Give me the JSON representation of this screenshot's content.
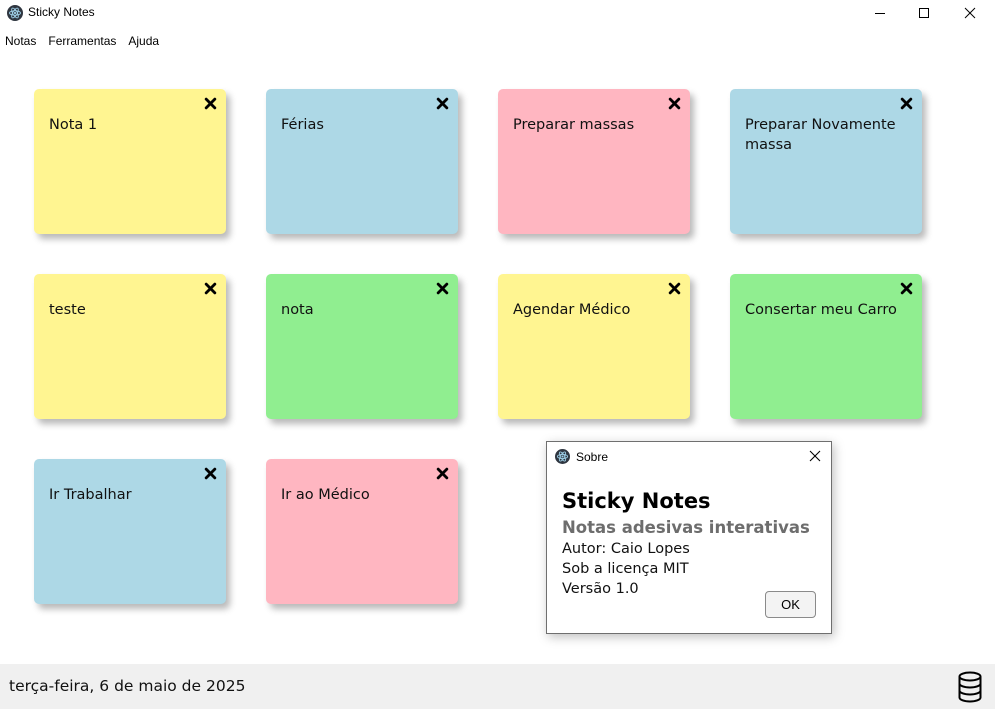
{
  "window": {
    "title": "Sticky Notes",
    "controls": [
      "minimize-icon",
      "maximize-icon",
      "close-icon"
    ]
  },
  "menu": {
    "items": [
      {
        "label": "Notas"
      },
      {
        "label": "Ferramentas"
      },
      {
        "label": "Ajuda"
      }
    ]
  },
  "colors": {
    "yellow": "#fff591",
    "blue": "#add8e6",
    "pink": "#ffb6c1",
    "green": "#90ee90"
  },
  "notes": [
    {
      "text": "Nota 1",
      "color": "#fff591"
    },
    {
      "text": "Férias",
      "color": "#add8e6"
    },
    {
      "text": "Preparar massas",
      "color": "#ffb6c1"
    },
    {
      "text": "Preparar Novamente massa",
      "color": "#add8e6"
    },
    {
      "text": "teste",
      "color": "#fff591"
    },
    {
      "text": "nota",
      "color": "#90ee90"
    },
    {
      "text": "Agendar Médico",
      "color": "#fff591"
    },
    {
      "text": "Consertar meu Carro",
      "color": "#90ee90"
    },
    {
      "text": "Ir Trabalhar",
      "color": "#add8e6"
    },
    {
      "text": "Ir ao Médico",
      "color": "#ffb6c1"
    }
  ],
  "status": {
    "date": "terça-feira, 6 de maio de 2025",
    "icon": "database-icon"
  },
  "about_dialog": {
    "title": "Sobre",
    "app_name": "Sticky Notes",
    "subtitle": "Notas adesivas interativas",
    "author": "Autor: Caio Lopes",
    "license": "Sob a licença MIT",
    "version": "Versão 1.0",
    "ok_label": "OK"
  }
}
